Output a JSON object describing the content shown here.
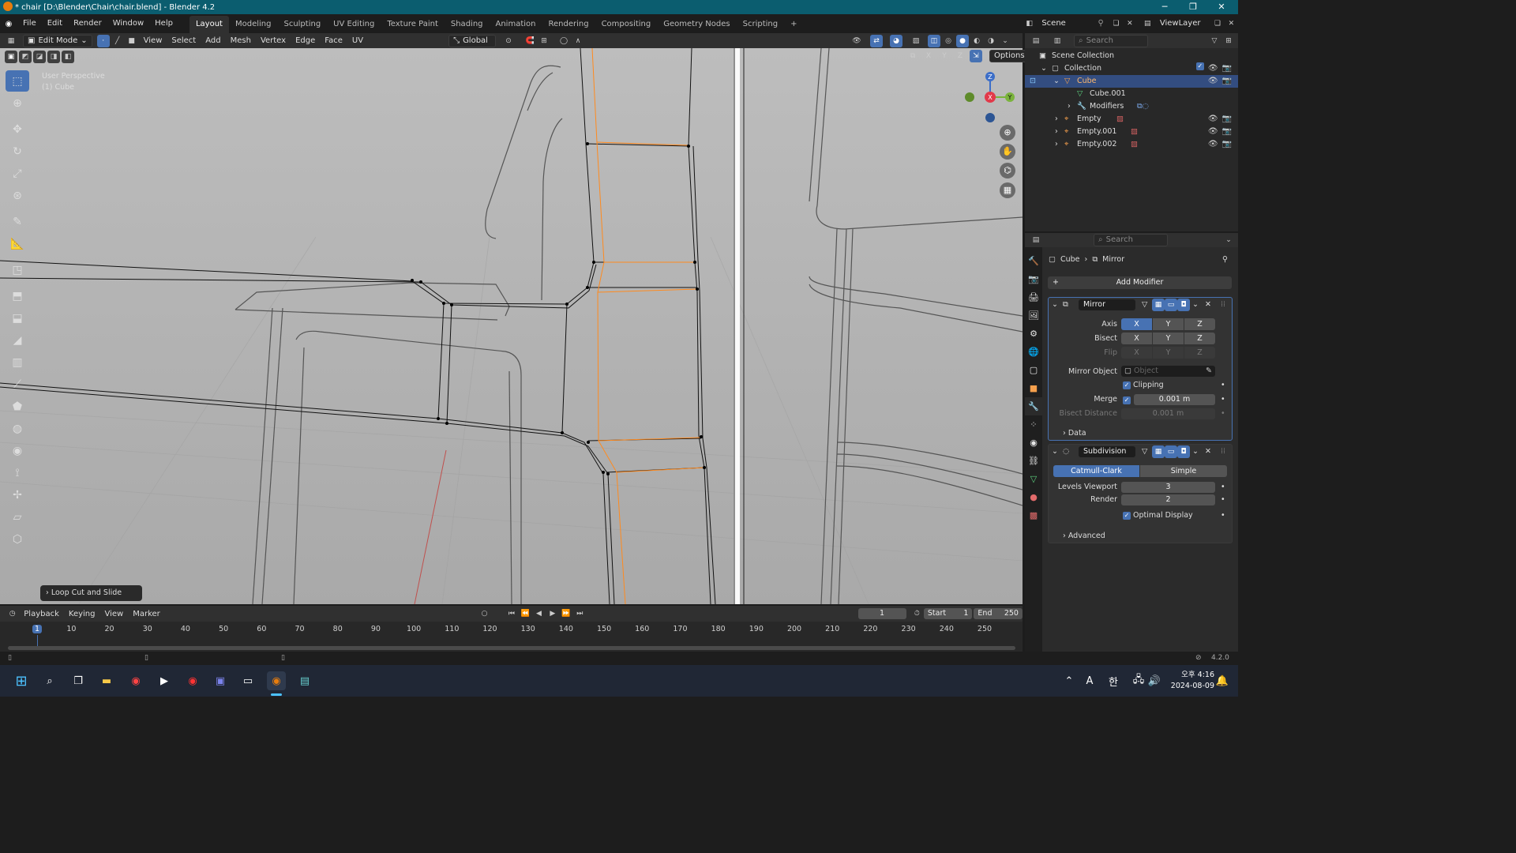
{
  "window": {
    "title": "* chair [D:\\Blender\\Chair\\chair.blend] - Blender 4.2"
  },
  "menu": [
    "File",
    "Edit",
    "Render",
    "Window",
    "Help"
  ],
  "workspaces": [
    "Layout",
    "Modeling",
    "Sculpting",
    "UV Editing",
    "Texture Paint",
    "Shading",
    "Animation",
    "Rendering",
    "Compositing",
    "Geometry Nodes",
    "Scripting"
  ],
  "active_workspace": "Layout",
  "scene": {
    "label": "Scene",
    "viewlayer": "ViewLayer"
  },
  "viewport_header": {
    "mode": "Edit Mode",
    "menus": [
      "View",
      "Select",
      "Add",
      "Mesh",
      "Vertex",
      "Edge",
      "Face",
      "UV"
    ],
    "orientation": "Global",
    "options": "Options",
    "axes": [
      "X",
      "Y",
      "Z"
    ]
  },
  "viewport": {
    "line1": "User Perspective",
    "line2": "(1) Cube",
    "operator": "Loop Cut and Slide"
  },
  "gizmo": {
    "z": "Z",
    "x": "X",
    "y": "Y"
  },
  "timeline": {
    "menus": [
      "Playback",
      "Keying",
      "View",
      "Marker"
    ],
    "current_frame": "1",
    "start_label": "Start",
    "start": "1",
    "end_label": "End",
    "end": "250",
    "ticks": [
      "1",
      "10",
      "20",
      "30",
      "40",
      "50",
      "60",
      "70",
      "80",
      "90",
      "100",
      "110",
      "120",
      "130",
      "140",
      "150",
      "160",
      "170",
      "180",
      "190",
      "200",
      "210",
      "220",
      "230",
      "240",
      "250"
    ]
  },
  "outliner": {
    "search_placeholder": "Search",
    "rows": [
      {
        "label": "Scene Collection",
        "icon": "scene-collection-icon",
        "indent": 0
      },
      {
        "label": "Collection",
        "icon": "collection-icon",
        "indent": 1
      },
      {
        "label": "Cube",
        "icon": "mesh-object-icon",
        "indent": 2,
        "selected": true
      },
      {
        "label": "Cube.001",
        "icon": "mesh-data-icon",
        "indent": 3
      },
      {
        "label": "Modifiers",
        "icon": "wrench-icon",
        "indent": 3
      },
      {
        "label": "Empty",
        "icon": "empty-icon",
        "indent": 2
      },
      {
        "label": "Empty.001",
        "icon": "empty-icon",
        "indent": 2
      },
      {
        "label": "Empty.002",
        "icon": "empty-icon",
        "indent": 2
      }
    ]
  },
  "properties": {
    "search_placeholder": "Search",
    "breadcrumb": {
      "object": "Cube",
      "modifier": "Mirror"
    },
    "add_modifier": "Add Modifier",
    "mirror": {
      "name": "Mirror",
      "axis_label": "Axis",
      "bisect_label": "Bisect",
      "flip_label": "Flip",
      "x": "X",
      "y": "Y",
      "z": "Z",
      "mirror_object_label": "Mirror Object",
      "mirror_object_placeholder": "Object",
      "clipping": "Clipping",
      "merge_label": "Merge",
      "merge_value": "0.001 m",
      "bisect_distance_label": "Bisect Distance",
      "bisect_distance_value": "0.001 m",
      "data": "Data"
    },
    "subdivision": {
      "name": "Subdivision",
      "catmull": "Catmull-Clark",
      "simple": "Simple",
      "levels_viewport_label": "Levels Viewport",
      "levels_viewport": "3",
      "render_label": "Render",
      "render": "2",
      "optimal_display": "Optimal Display",
      "advanced": "Advanced"
    }
  },
  "status": {
    "version": "4.2.0"
  },
  "taskbar": {
    "lang": "A",
    "ime": "한",
    "time": "오후 4:16",
    "date": "2024-08-09"
  },
  "colors": {
    "accent": "#4772b3",
    "selected_row": "#334d80",
    "edge_orange": "#ff8a1e",
    "viewport_bg": "#3d3d3d"
  }
}
